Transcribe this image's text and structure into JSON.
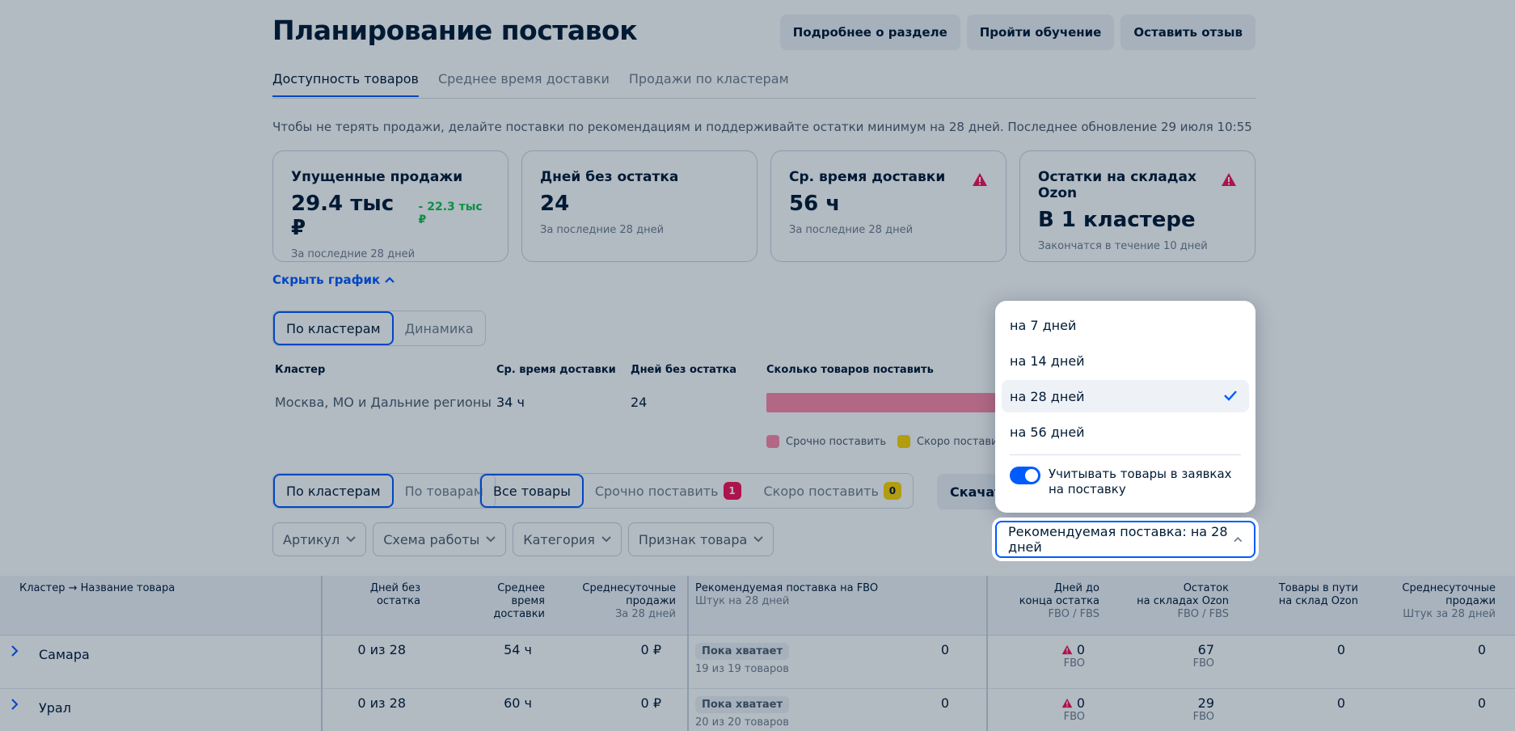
{
  "header": {
    "title": "Планирование поставок",
    "buttons": [
      "Подробнее о разделе",
      "Пройти обучение",
      "Оставить отзыв"
    ]
  },
  "tabs": [
    {
      "label": "Доступность товаров",
      "active": true
    },
    {
      "label": "Среднее время доставки",
      "active": false
    },
    {
      "label": "Продажи по кластерам",
      "active": false
    }
  ],
  "info_text": "Чтобы не терять продажи, делайте поставки по рекомендациям и поддерживайте остатки минимум на 28 дней. Последнее обновление 29 июля 10:55",
  "cards": [
    {
      "title": "Упущенные продажи",
      "value": "29.4 тыс ₽",
      "delta": "- 22.3 тыс ₽",
      "sub": "За последние 28 дней",
      "warning": false
    },
    {
      "title": "Дней без остатка",
      "value": "24",
      "delta": "",
      "sub": "За последние 28 дней",
      "warning": false
    },
    {
      "title": "Ср. время доставки",
      "value": "56 ч",
      "delta": "",
      "sub": "За последние 28 дней",
      "warning": true
    },
    {
      "title": "Остатки на складах Ozon",
      "value": "В 1 кластере",
      "delta": "",
      "sub": "Закончатся в течение 10 дней",
      "warning": true
    }
  ],
  "hide_chart_label": "Скрыть график",
  "chart_toggle": [
    "По кластерам",
    "Динамика"
  ],
  "cluster_table": {
    "headers": [
      "Кластер",
      "Ср. время доставки",
      "Дней без остатка",
      "Сколько товаров поставить"
    ],
    "row": [
      "Москва, МО и Дальние регионы",
      "34 ч",
      "24"
    ]
  },
  "legend": [
    {
      "label": "Срочно поставить",
      "color": "#ff8aa8"
    },
    {
      "label": "Скоро поставить",
      "color": "#ffd400"
    }
  ],
  "view_toggle": [
    "По кластерам",
    "По товарам"
  ],
  "goods_filter": [
    {
      "label": "Все товары",
      "badge": ""
    },
    {
      "label": "Срочно поставить",
      "badge": "1"
    },
    {
      "label": "Скоро поставить",
      "badge": "0"
    }
  ],
  "download_label": "Скачать",
  "filters": [
    "Артикул",
    "Схема работы",
    "Категория",
    "Признак товара"
  ],
  "dropdown": {
    "options": [
      "на 7 дней",
      "на 14 дней",
      "на 28 дней",
      "на 56 дней"
    ],
    "selected_index": 2,
    "toggle_label_1": "Учитывать товары в заявках",
    "toggle_label_2": "на поставку",
    "toggle_on": true
  },
  "select_value": "Рекомендуемая поставка: на 28 дней",
  "data_table": {
    "headers": {
      "name": "Кластер → Название товара",
      "days_no_stock_1": "Дней без",
      "days_no_stock_2": "остатка",
      "avg_time_1": "Среднее",
      "avg_time_2": "время",
      "avg_time_3": "доставки",
      "avg_sales_1": "Среднесуточные",
      "avg_sales_2": "продажи",
      "avg_sales_3": "За 28 дней",
      "rec_1": "Рекомендуемая поставка на FBO",
      "rec_2": "Штук на 28 дней",
      "days_end_1": "Дней до",
      "days_end_2": "конца остатка",
      "days_end_3": "FBO / FBS",
      "stock_1": "Остаток",
      "stock_2": "на складах Ozon",
      "stock_3": "FBO / FBS",
      "transit_1": "Товары в пути",
      "transit_2": "на склад Ozon",
      "avg2_1": "Среднесуточные",
      "avg2_2": "продажи",
      "avg2_3": "Штук за 28 дней"
    },
    "rows": [
      {
        "name": "Самара",
        "days": "0 из 28",
        "time": "54 ч",
        "sales": "0 ₽",
        "status": "Пока хватает",
        "status_sub": "19 из 19 товаров",
        "rec": "0",
        "days_end": "0",
        "days_end_sub": "FBO",
        "stock": "67",
        "stock_sub": "FBO",
        "transit": "0",
        "avg2": "0"
      },
      {
        "name": "Урал",
        "days": "0 из 28",
        "time": "60 ч",
        "sales": "0 ₽",
        "status": "Пока хватает",
        "status_sub": "20 из 20 товаров",
        "rec": "0",
        "days_end": "0",
        "days_end_sub": "FBO",
        "stock": "29",
        "stock_sub": "FBO",
        "transit": "0",
        "avg2": "0"
      }
    ]
  },
  "colors": {
    "accent": "#005bff",
    "success": "#10c44c",
    "danger": "#f91155",
    "warning": "#ffd400"
  }
}
